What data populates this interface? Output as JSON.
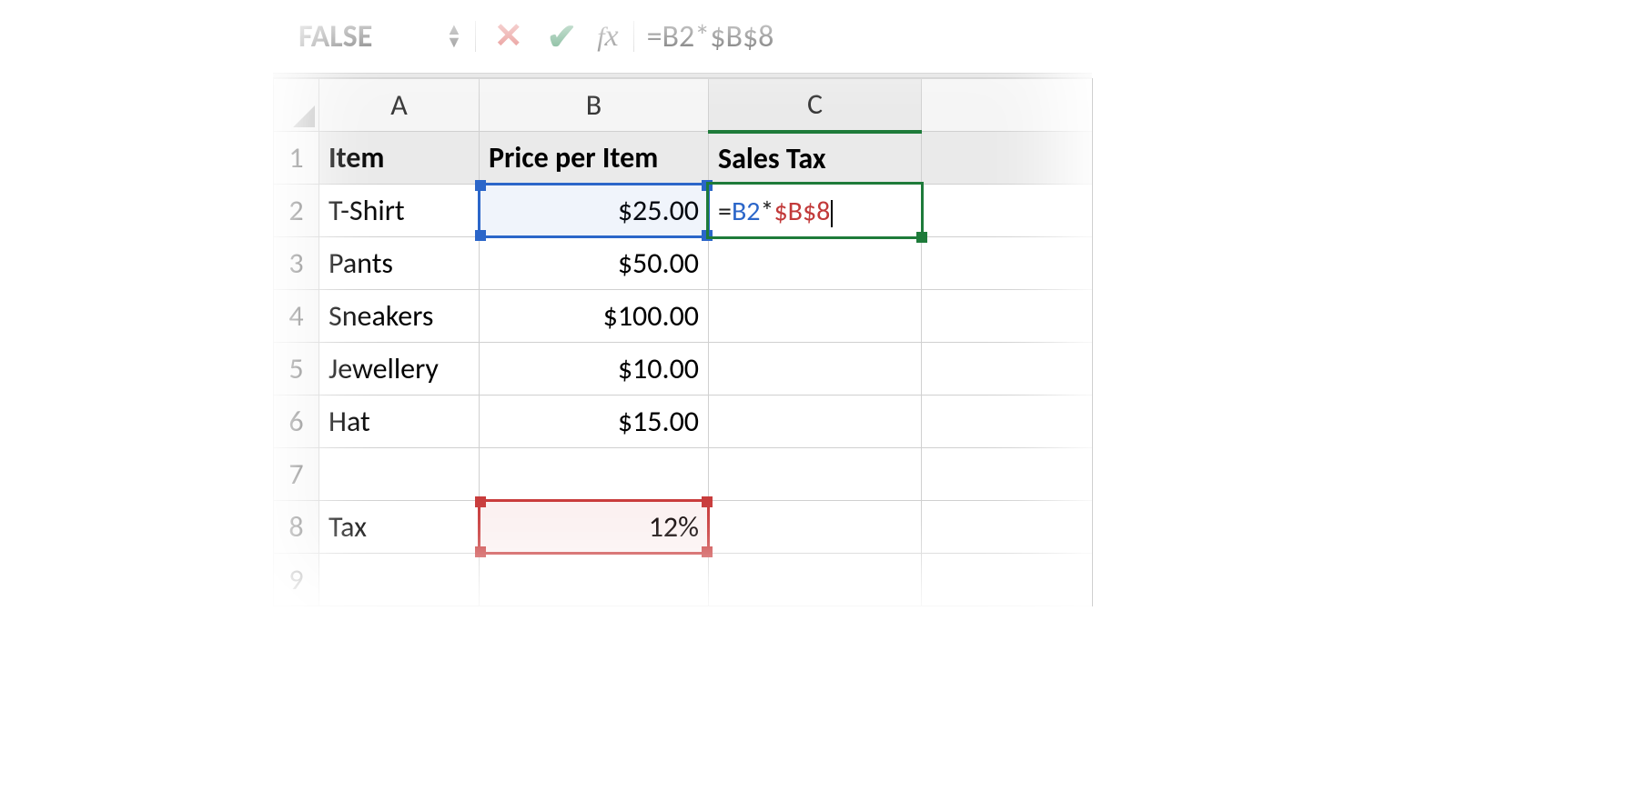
{
  "formula_bar": {
    "name_box": "FALSE",
    "formula": "=B2*$B$8"
  },
  "columns": {
    "A": "A",
    "B": "B",
    "C": "C"
  },
  "rows": {
    "r1": "1",
    "r2": "2",
    "r3": "3",
    "r4": "4",
    "r5": "5",
    "r6": "6",
    "r7": "7",
    "r8": "8",
    "r9": "9"
  },
  "headers": {
    "item": "Item",
    "price": "Price per Item",
    "tax": "Sales Tax"
  },
  "data": {
    "A2": "T-Shirt",
    "B2": "$25.00",
    "A3": "Pants",
    "B3": "$50.00",
    "A4": "Sneakers",
    "B4": "$100.00",
    "A5": "Jewellery",
    "B5": "$10.00",
    "A6": "Hat",
    "B6": "$15.00",
    "A8": "Tax",
    "B8": "12%"
  },
  "editing": {
    "eq": "=",
    "ref1": "B2",
    "op": "*",
    "ref2": "$B$8"
  },
  "colors": {
    "ref_blue": "#2b66c9",
    "ref_red": "#c83a3a",
    "active_green": "#1e7b3a"
  }
}
